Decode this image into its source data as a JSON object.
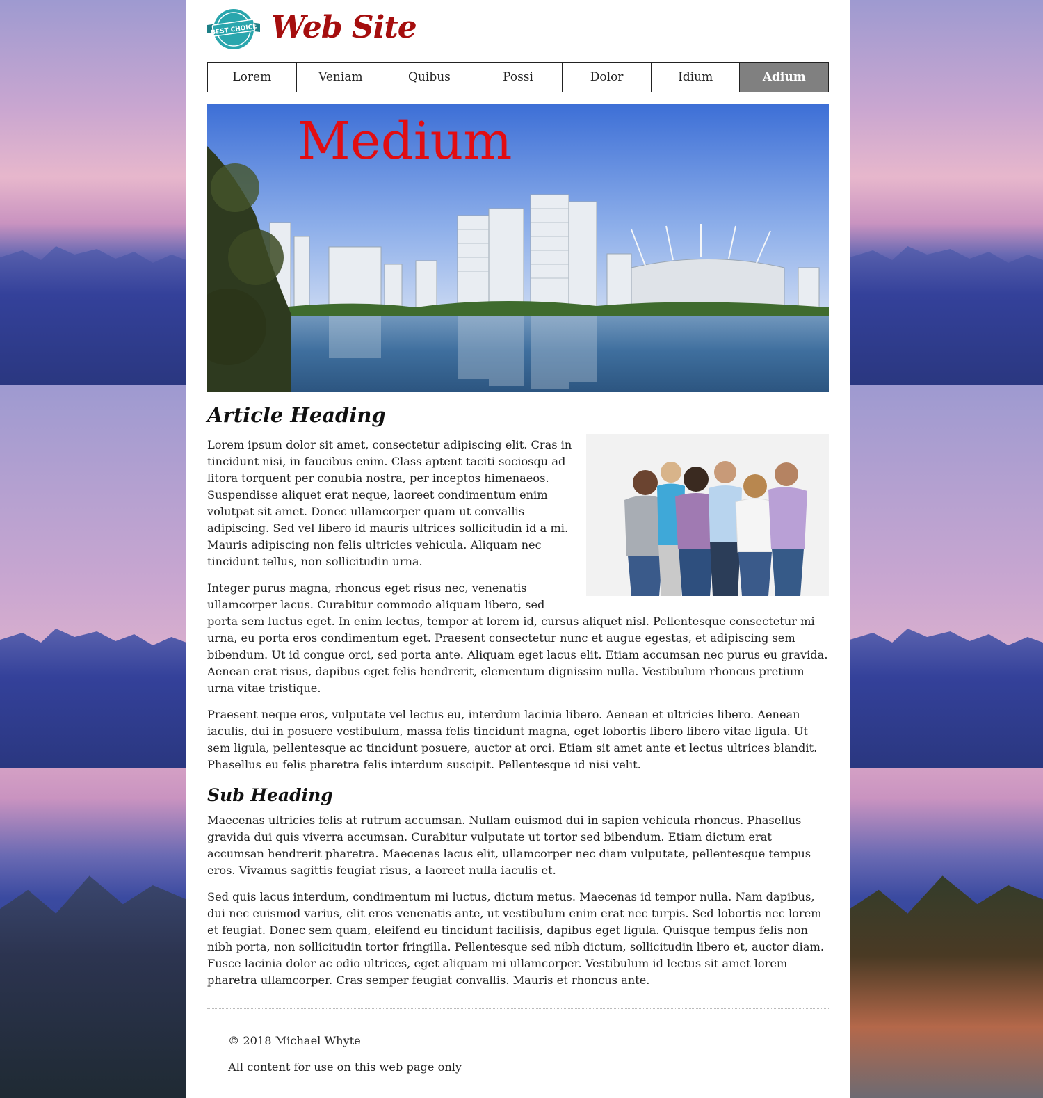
{
  "header": {
    "badge_text": "BEST CHOICE",
    "site_title": "Web Site"
  },
  "nav": {
    "items": [
      "Lorem",
      "Veniam",
      "Quibus",
      "Possi",
      "Dolor",
      "Idium",
      "Adium"
    ],
    "active": "Adium"
  },
  "hero": {
    "title": "Medium"
  },
  "article": {
    "heading": "Article Heading",
    "paragraphs": [
      "Lorem ipsum dolor sit amet, consectetur adipiscing elit. Cras in tincidunt nisi, in faucibus enim. Class aptent taciti sociosqu ad litora torquent per conubia nostra, per inceptos himenaeos. Suspendisse aliquet erat neque, laoreet condimentum enim volutpat sit amet. Donec ullamcorper quam ut convallis adipiscing. Sed vel libero id mauris ultrices sollicitudin id a mi. Mauris adipiscing non felis ultricies vehicula. Aliquam nec tincidunt tellus, non sollicitudin urna.",
      "Integer purus magna, rhoncus eget risus nec, venenatis ullamcorper lacus. Curabitur commodo aliquam libero, sed porta sem luctus eget. In enim lectus, tempor at lorem id, cursus aliquet nisl. Pellentesque consectetur mi urna, eu porta eros condimentum eget. Praesent consectetur nunc et augue egestas, et adipiscing sem bibendum. Ut id congue orci, sed porta ante. Aliquam eget lacus elit. Etiam accumsan nec purus eu gravida. Aenean erat risus, dapibus eget felis hendrerit, elementum dignissim nulla. Vestibulum rhoncus pretium urna vitae tristique.",
      "Praesent neque eros, vulputate vel lectus eu, interdum lacinia libero. Aenean et ultricies libero. Aenean iaculis, dui in posuere vestibulum, massa felis tincidunt magna, eget lobortis libero libero vitae ligula. Ut sem ligula, pellentesque ac tincidunt posuere, auctor at orci. Etiam sit amet ante et lectus ultrices blandit. Phasellus eu felis pharetra felis interdum suscipit. Pellentesque id nisi velit."
    ],
    "sub_heading": "Sub Heading",
    "sub_paragraphs": [
      "Maecenas ultricies felis at rutrum accumsan. Nullam euismod dui in sapien vehicula rhoncus. Phasellus gravida dui quis viverra accumsan. Curabitur vulputate ut tortor sed bibendum. Etiam dictum erat accumsan hendrerit pharetra. Maecenas lacus elit, ullamcorper nec diam vulputate, pellentesque tempus eros. Vivamus sagittis feugiat risus, a laoreet nulla iaculis et.",
      "Sed quis lacus interdum, condimentum mi luctus, dictum metus. Maecenas id tempor nulla. Nam dapibus, dui nec euismod varius, elit eros venenatis ante, ut vestibulum enim erat nec turpis. Sed lobortis nec lorem et feugiat. Donec sem quam, eleifend eu tincidunt facilisis, dapibus eget ligula. Quisque tempus felis non nibh porta, non sollicitudin tortor fringilla. Pellentesque sed nibh dictum, sollicitudin libero et, auctor diam. Fusce lacinia dolor ac odio ultrices, eget aliquam mi ullamcorper. Vestibulum id lectus sit amet lorem pharetra ullamcorper. Cras semper feugiat convallis. Mauris et rhoncus ante."
    ]
  },
  "footer": {
    "copyright": "© 2018 Michael Whyte",
    "note": "All content for use on this web page only"
  },
  "colors": {
    "site_title": "#a50e0e",
    "hero_title": "#e10d12",
    "nav_active_bg": "#808080",
    "badge_teal": "#2aa6ad"
  }
}
